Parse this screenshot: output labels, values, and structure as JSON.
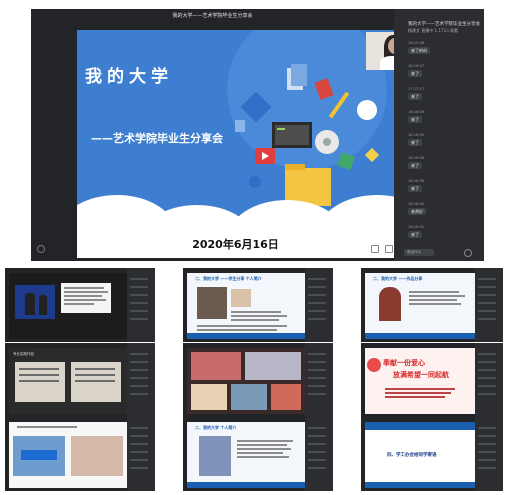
{
  "main": {
    "window_title": "我的大学——艺术学院毕业生分享会",
    "slide": {
      "title": "我的大学",
      "subtitle": "——艺术学院毕业生分享会",
      "date": "2020年6月16日"
    },
    "chat_panel": {
      "title": "我的大学——艺术学院毕业生分享会",
      "subtitle": "杨建文 直播中 1,173人观看",
      "messages": [
        {
          "time": "16:15:06",
          "text": "来了的吗"
        },
        {
          "time": "16:16:07",
          "text": "来了"
        },
        {
          "time": "17:17:17",
          "text": "来了"
        },
        {
          "time": "16:16:09",
          "text": "来了"
        },
        {
          "time": "16:16:09",
          "text": "来了"
        },
        {
          "time": "16:16:06",
          "text": "来了"
        },
        {
          "time": "16:16:39",
          "text": "来了"
        },
        {
          "time": "16:16:40",
          "text": "老师好"
        },
        {
          "time": "16:16:41",
          "text": "来了"
        }
      ],
      "input_placeholder": "说点什么"
    }
  },
  "thumbnails": [
    {
      "caption": "我的大学 个人简介"
    },
    {
      "caption": "二、我的大学 ——学生分享 个人简介"
    },
    {
      "caption": "二、我的大学 ——作品分享"
    },
    {
      "caption": "专业实践作品"
    },
    {
      "caption": "生活照片"
    },
    {
      "caption": "奉献一份爱心 放满希望一同起航"
    },
    {
      "caption": "志愿活动"
    },
    {
      "caption": "二、我的大学 个人简介"
    },
    {
      "caption": "四、学工办老师寄语"
    }
  ],
  "thumb_texts": {
    "t5_line1": "奉献一份爱心",
    "t5_line2": "放满希望一同起航",
    "t8": "四、学工办会给同学寄语"
  },
  "colors": {
    "slide_blue": "#3d7ed1",
    "window_dark": "#222428",
    "panel_dark": "#2b2d31"
  }
}
